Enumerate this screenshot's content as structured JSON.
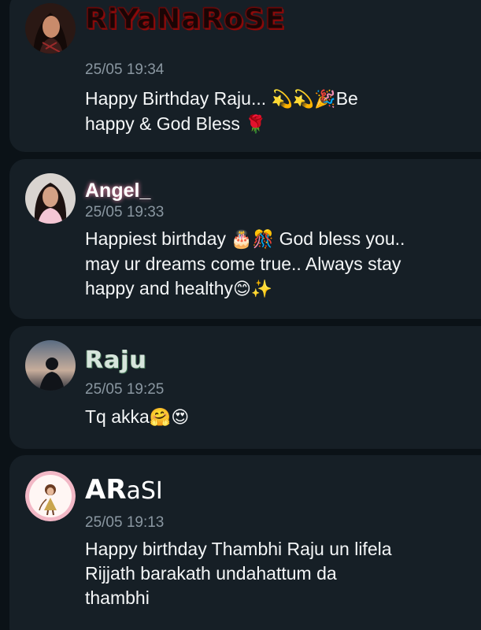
{
  "comments": [
    {
      "username": "RiYaNaRoSE",
      "time": "25/05 19:34",
      "message_line1": "Happy Birthday Raju...",
      "message_line1_emoji": "💫💫🎉",
      "message_line1_tail": "Be",
      "message_line2": "happy & God Bless",
      "message_line2_emoji": "🌹"
    },
    {
      "username": "Angel_",
      "time": "25/05 19:33",
      "message_line1": "Happiest birthday",
      "message_line1_emoji": "🎂🎊",
      "message_line1_tail": "God bless you..",
      "message_line2": "may ur dreams come true.. Always stay",
      "message_line3": "happy and healthy",
      "message_line3_emoji": "😊✨"
    },
    {
      "username": "Raju",
      "time": "25/05 19:25",
      "message_line1": "Tq akka",
      "message_line1_emoji": "🤗😍"
    },
    {
      "username_big": "AR",
      "username_small": "aSI",
      "time": "25/05 19:13",
      "message_line1": "Happy birthday Thambhi Raju un lifela",
      "message_line2": "Rijjath barakath undahattum da",
      "message_line3": "thambhi"
    }
  ],
  "colors": {
    "background": "#0b1217",
    "card": "#161f26",
    "timestamp": "#8a97a1",
    "text": "#f4f6f7"
  }
}
